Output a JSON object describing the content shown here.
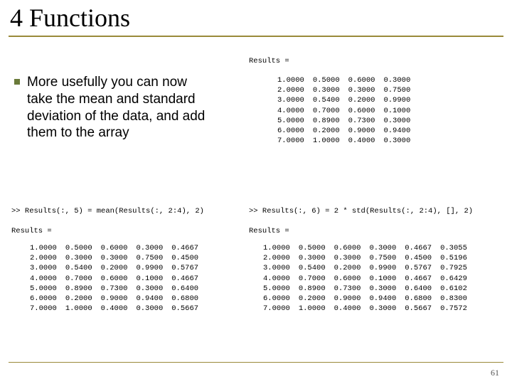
{
  "slide": {
    "title": "4 Functions",
    "bullet": "More usefully you can now take the mean and standard deviation of the data, and add them to the array",
    "page_number": "61"
  },
  "top": {
    "header": "Results =",
    "rows": [
      [
        "1.0000",
        "0.5000",
        "0.6000",
        "0.3000"
      ],
      [
        "2.0000",
        "0.3000",
        "0.3000",
        "0.7500"
      ],
      [
        "3.0000",
        "0.5400",
        "0.2000",
        "0.9900"
      ],
      [
        "4.0000",
        "0.7000",
        "0.6000",
        "0.1000"
      ],
      [
        "5.0000",
        "0.8900",
        "0.7300",
        "0.3000"
      ],
      [
        "6.0000",
        "0.2000",
        "0.9000",
        "0.9400"
      ],
      [
        "7.0000",
        "1.0000",
        "0.4000",
        "0.3000"
      ]
    ]
  },
  "bottom_left": {
    "command": ">> Results(:, 5) = mean(Results(:, 2:4), 2)\n\nResults =",
    "rows": [
      [
        "1.0000",
        "0.5000",
        "0.6000",
        "0.3000",
        "0.4667"
      ],
      [
        "2.0000",
        "0.3000",
        "0.3000",
        "0.7500",
        "0.4500"
      ],
      [
        "3.0000",
        "0.5400",
        "0.2000",
        "0.9900",
        "0.5767"
      ],
      [
        "4.0000",
        "0.7000",
        "0.6000",
        "0.1000",
        "0.4667"
      ],
      [
        "5.0000",
        "0.8900",
        "0.7300",
        "0.3000",
        "0.6400"
      ],
      [
        "6.0000",
        "0.2000",
        "0.9000",
        "0.9400",
        "0.6800"
      ],
      [
        "7.0000",
        "1.0000",
        "0.4000",
        "0.3000",
        "0.5667"
      ]
    ]
  },
  "bottom_right": {
    "command": ">> Results(:, 6) = 2 * std(Results(:, 2:4), [], 2)\n\nResults =",
    "rows": [
      [
        "1.0000",
        "0.5000",
        "0.6000",
        "0.3000",
        "0.4667",
        "0.3055"
      ],
      [
        "2.0000",
        "0.3000",
        "0.3000",
        "0.7500",
        "0.4500",
        "0.5196"
      ],
      [
        "3.0000",
        "0.5400",
        "0.2000",
        "0.9900",
        "0.5767",
        "0.7925"
      ],
      [
        "4.0000",
        "0.7000",
        "0.6000",
        "0.1000",
        "0.4667",
        "0.6429"
      ],
      [
        "5.0000",
        "0.8900",
        "0.7300",
        "0.3000",
        "0.6400",
        "0.6102"
      ],
      [
        "6.0000",
        "0.2000",
        "0.9000",
        "0.9400",
        "0.6800",
        "0.8300"
      ],
      [
        "7.0000",
        "1.0000",
        "0.4000",
        "0.3000",
        "0.5667",
        "0.7572"
      ]
    ]
  }
}
